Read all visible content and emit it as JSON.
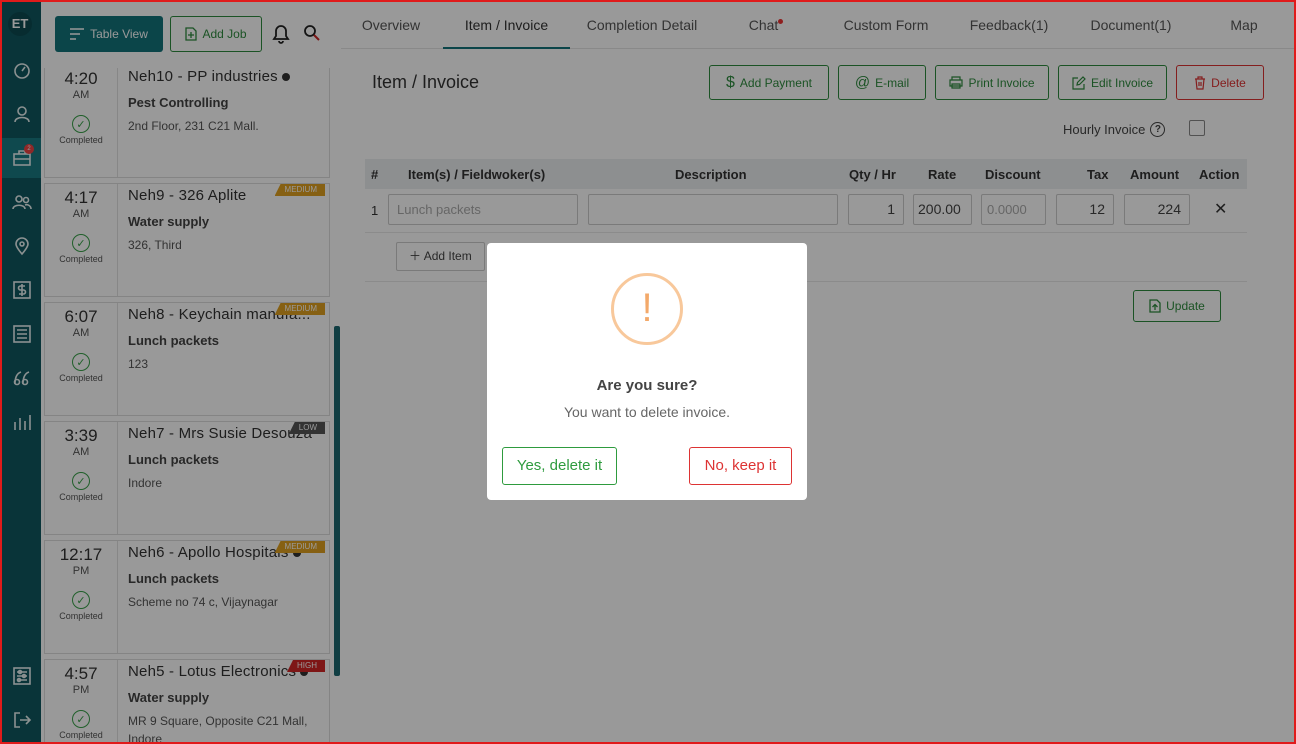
{
  "brand": {
    "logo_text": "ET"
  },
  "rail": {
    "items": [
      {
        "icon": "dashboard-icon"
      },
      {
        "icon": "user-icon"
      },
      {
        "icon": "briefcase-icon",
        "badge": "2"
      },
      {
        "icon": "users-icon"
      },
      {
        "icon": "map-pin-icon"
      },
      {
        "icon": "dollar-icon"
      },
      {
        "icon": "list-icon"
      },
      {
        "icon": "quote-icon"
      },
      {
        "icon": "bar-chart-icon"
      },
      {
        "icon": "settings-sliders-icon"
      },
      {
        "icon": "logout-icon"
      }
    ]
  },
  "toolbar": {
    "table_view_label": "Table View",
    "add_job_label": "Add Job"
  },
  "jobs": [
    {
      "time": "4:20",
      "ampm": "AM",
      "status": "Completed",
      "title": "Neh10 - PP industries",
      "sub": "Pest Controlling",
      "addr": "2nd Floor, 231 C21 Mall.",
      "priority": "",
      "dot": true
    },
    {
      "time": "4:17",
      "ampm": "AM",
      "status": "Completed",
      "title": "Neh9 - 326 Aplite",
      "sub": "Water supply",
      "addr": "326, Third",
      "priority": "MEDIUM",
      "dot": false
    },
    {
      "time": "6:07",
      "ampm": "AM",
      "status": "Completed",
      "title": "Neh8 - Keychain manufa...",
      "sub": "Lunch packets",
      "addr": "123",
      "priority": "MEDIUM",
      "dot": false
    },
    {
      "time": "3:39",
      "ampm": "AM",
      "status": "Completed",
      "title": "Neh7 - Mrs Susie Desouza",
      "sub": "Lunch packets",
      "addr": "Indore",
      "priority": "LOW",
      "dot": false
    },
    {
      "time": "12:17",
      "ampm": "PM",
      "status": "Completed",
      "title": "Neh6 - Apollo Hospitals",
      "sub": "Lunch packets",
      "addr": "Scheme no 74 c, Vijaynagar",
      "priority": "MEDIUM",
      "dot": true
    },
    {
      "time": "4:57",
      "ampm": "PM",
      "status": "Completed",
      "title": "Neh5 - Lotus Electronics",
      "sub": "Water supply",
      "addr": "MR 9 Square, Opposite C21 Mall, Indore",
      "priority": "HIGH",
      "dot": true
    }
  ],
  "priority_colors": {
    "MEDIUM": "#e0a020",
    "LOW": "#555555",
    "HIGH": "#d32626"
  },
  "tabs": [
    {
      "label": "Overview"
    },
    {
      "label": "Item / Invoice",
      "active": true
    },
    {
      "label": "Completion Detail"
    },
    {
      "label": "Chat"
    },
    {
      "label": "Custom Form"
    },
    {
      "label": "Feedback(1)"
    },
    {
      "label": "Document(1)"
    },
    {
      "label": "Map"
    }
  ],
  "invoice": {
    "title": "Item / Invoice",
    "actions": {
      "add_payment": "Add Payment",
      "email": "E-mail",
      "print": "Print Invoice",
      "edit": "Edit Invoice",
      "delete": "Delete"
    },
    "hourly_label": "Hourly Invoice",
    "columns": [
      "#",
      "Item(s) / Fieldwoker(s)",
      "Description",
      "Qty / Hr",
      "Rate",
      "Discount",
      "Tax",
      "Amount",
      "Action"
    ],
    "row": {
      "index": "1",
      "item_placeholder": "Lunch packets",
      "description": "",
      "qty": "1",
      "rate": "200.00",
      "discount_placeholder": "0.0000",
      "tax": "12",
      "amount": "224",
      "action": "✕"
    },
    "add_item_label": "Add Item",
    "update_label": "Update"
  },
  "dialog": {
    "icon_glyph": "!",
    "title": "Are you sure?",
    "text": "You want to delete invoice.",
    "confirm_label": "Yes, delete it",
    "cancel_label": "No, keep it"
  }
}
